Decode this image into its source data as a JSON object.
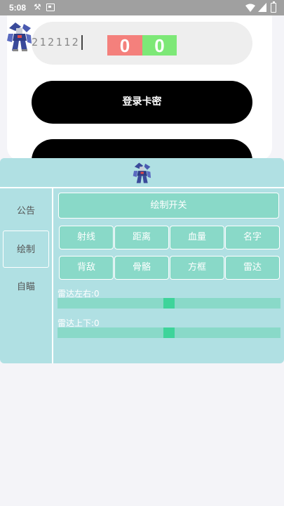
{
  "status_bar": {
    "time": "5:08",
    "icons": [
      "notification-icon",
      "screenshot-icon",
      "wifi-icon",
      "signal-icon",
      "battery-icon"
    ]
  },
  "login": {
    "card_key_value": "212112",
    "counter_red": "0",
    "counter_green": "0",
    "login_button": "登录卡密",
    "second_button": "",
    "logo": "mecha-robot-icon"
  },
  "menu": {
    "logo": "mecha-robot-icon",
    "tabs": [
      {
        "label": "公告",
        "active": false
      },
      {
        "label": "绘制",
        "active": true
      },
      {
        "label": "自瞄",
        "active": false
      }
    ],
    "draw_toggle": "绘制开关",
    "options_row1": [
      "射线",
      "距离",
      "血量",
      "名字"
    ],
    "options_row2": [
      "背敌",
      "骨骼",
      "方框",
      "雷达"
    ],
    "sliders": [
      {
        "label": "雷达左右:0",
        "value": 0,
        "min": -100,
        "max": 100
      },
      {
        "label": "雷达上下:0",
        "value": 0,
        "min": -100,
        "max": 100
      }
    ]
  },
  "colors": {
    "menu_bg": "#b0e0e3",
    "button_bg": "#89d9c8",
    "slider_thumb": "#3ed49a",
    "counter_red": "#f4807c",
    "counter_green": "#7de877"
  }
}
